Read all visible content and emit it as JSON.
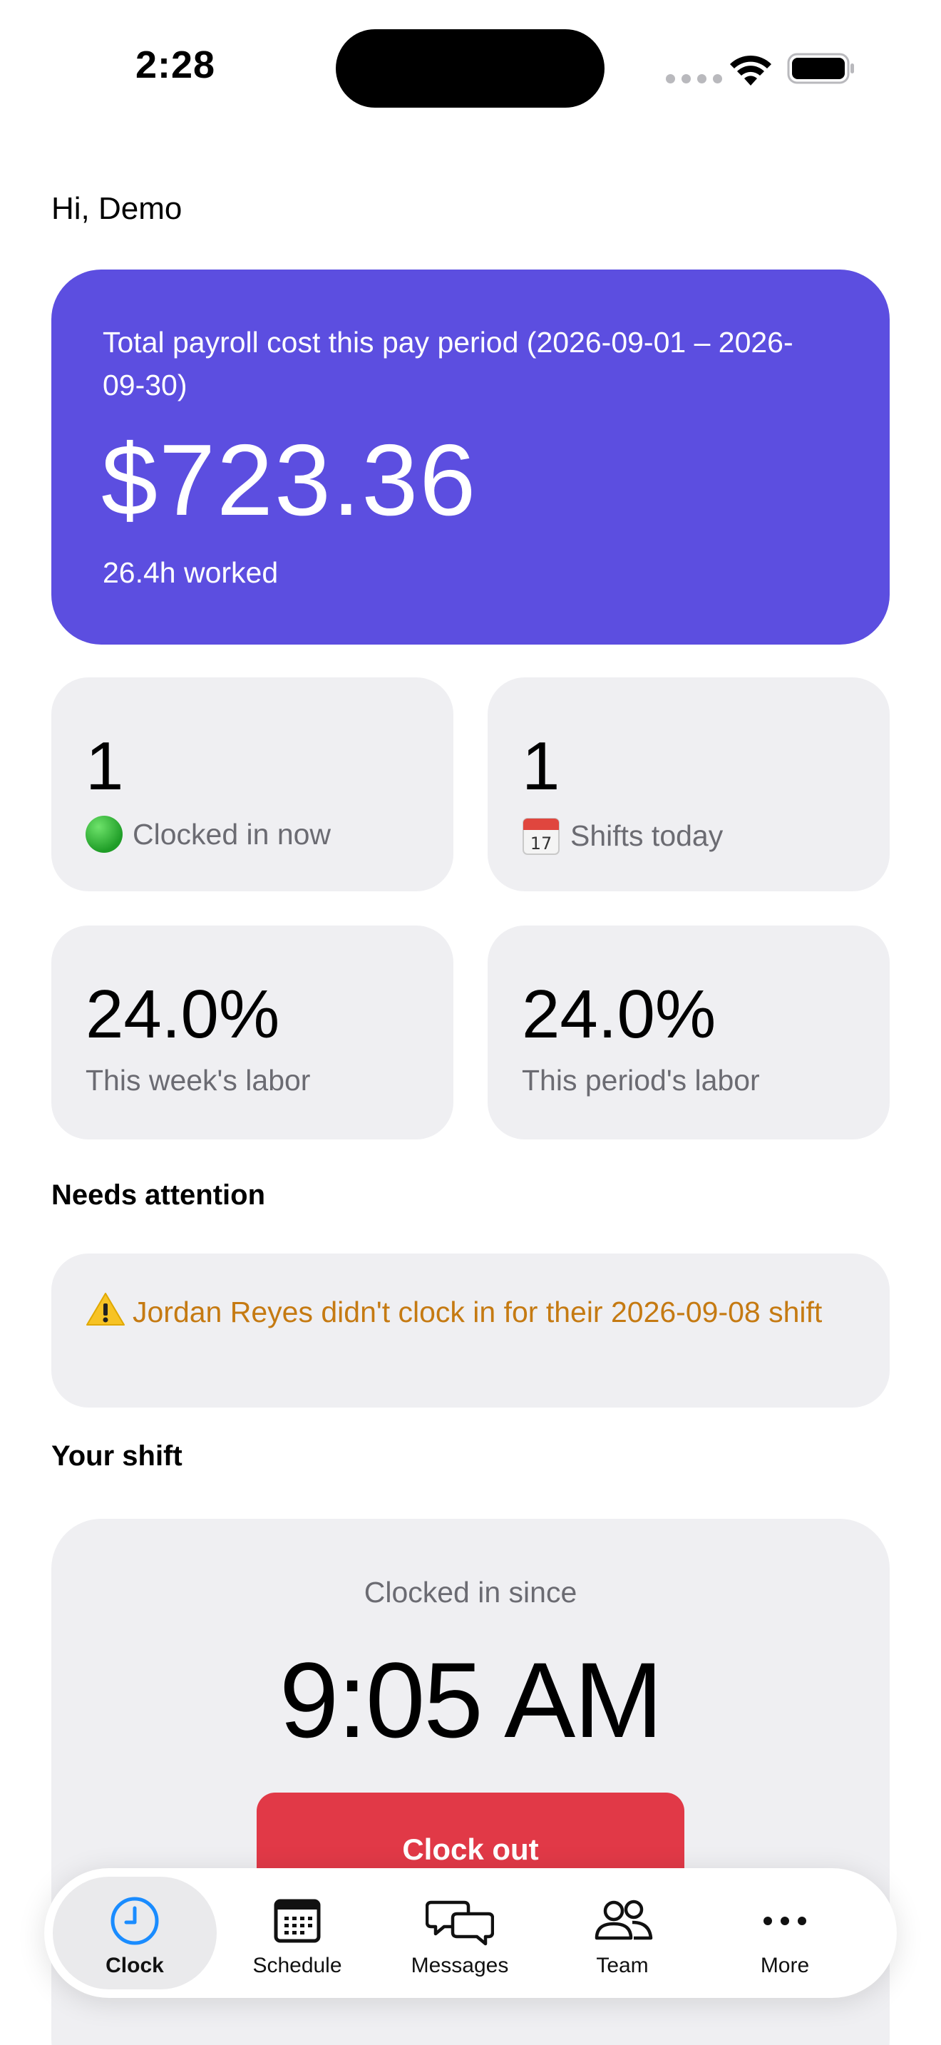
{
  "status_bar": {
    "time": "2:28"
  },
  "greeting": "Hi, Demo",
  "payroll": {
    "label": "Total payroll cost this pay period (2026-09-01 – 2026-09-30)",
    "amount": "$723.36",
    "hours": "26.4h worked"
  },
  "stats": [
    {
      "value": "1",
      "label": "Clocked in now",
      "icon": "green-circle-icon"
    },
    {
      "value": "1",
      "label": "Shifts today",
      "icon": "calendar-icon"
    },
    {
      "value": "24.0%",
      "label": "This week's labor"
    },
    {
      "value": "24.0%",
      "label": "This period's labor"
    }
  ],
  "attention": {
    "title": "Needs attention",
    "message": "Jordan Reyes didn't clock in for their 2026-09-08 shift",
    "icon": "warning-icon",
    "color": "#c57a12"
  },
  "shift": {
    "title": "Your shift",
    "label": "Clocked in since",
    "time": "9:05 AM",
    "button": "Clock out",
    "button_color": "#e13947"
  },
  "colors": {
    "accent": "#5c4ee0",
    "tab_active": "#1a8cff"
  },
  "tabs": [
    {
      "label": "Clock",
      "icon": "clock-icon",
      "active": true
    },
    {
      "label": "Schedule",
      "icon": "calendar-grid-icon"
    },
    {
      "label": "Messages",
      "icon": "chat-bubbles-icon"
    },
    {
      "label": "Team",
      "icon": "people-icon"
    },
    {
      "label": "More",
      "icon": "ellipsis-icon"
    }
  ]
}
